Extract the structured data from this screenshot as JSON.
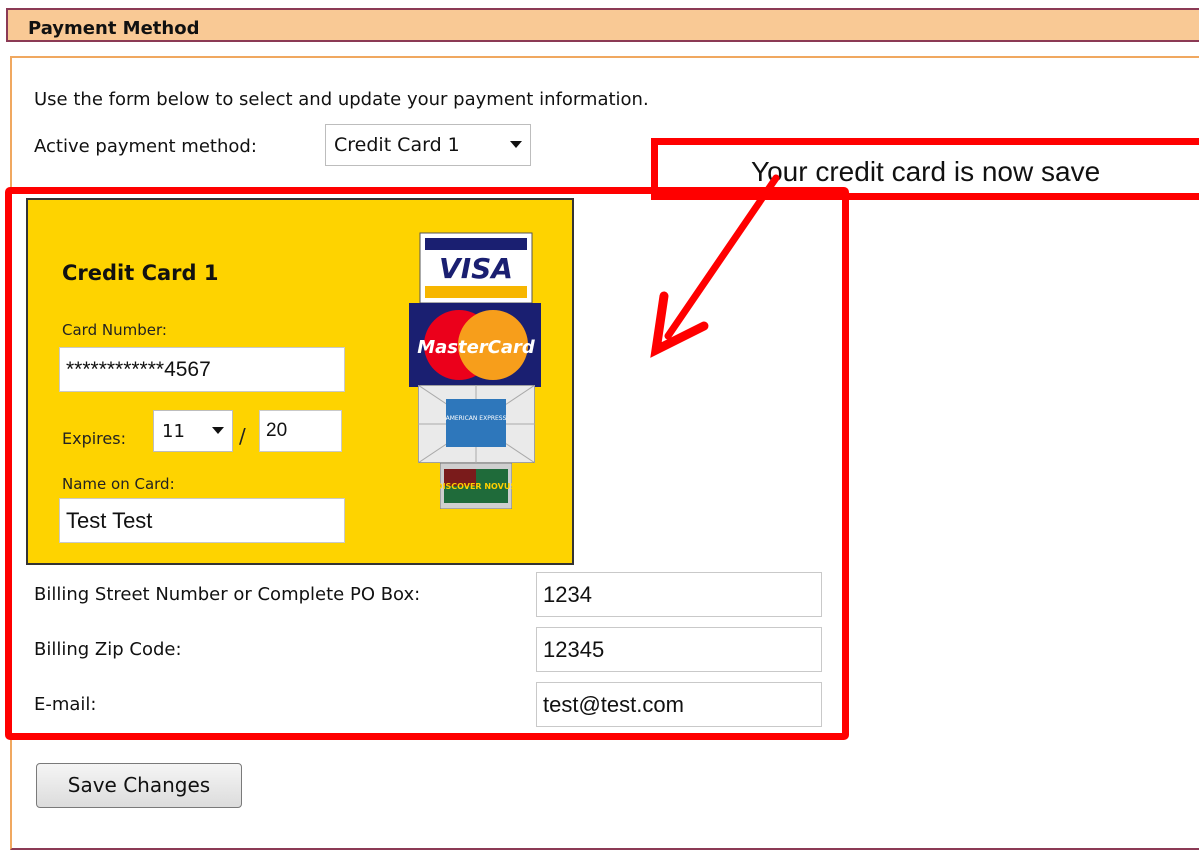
{
  "header": {
    "title": "Payment Method"
  },
  "intro": "Use the form below to select and update your payment information.",
  "active_method": {
    "label": "Active payment method:",
    "value": "Credit Card 1"
  },
  "callout": {
    "text": "Your credit card is now save"
  },
  "card": {
    "title": "Credit Card 1",
    "number_label": "Card Number:",
    "number_value": "************4567",
    "expires_label": "Expires:",
    "expires_month": "11",
    "expires_sep": "/",
    "expires_year": "20",
    "name_label": "Name on Card:",
    "name_value": "Test Test"
  },
  "logos": {
    "visa": {
      "name": "visa-logo",
      "text": "VISA"
    },
    "mastercard": {
      "name": "mastercard-logo",
      "text": "MasterCard"
    },
    "amex": {
      "name": "amex-logo",
      "text": "AMERICAN EXPRESS"
    },
    "discover": {
      "name": "discover-logo",
      "text": "DISCOVER NOVUS"
    }
  },
  "billing": {
    "street_label": "Billing Street Number or Complete PO Box:",
    "street_value": "1234",
    "zip_label": "Billing Zip Code:",
    "zip_value": "12345",
    "email_label": "E-mail:",
    "email_value": "test@test.com"
  },
  "buttons": {
    "save": "Save Changes"
  },
  "colors": {
    "header_bg": "#f9c995",
    "card_bg": "#fed300",
    "annotation": "#ff0000"
  }
}
